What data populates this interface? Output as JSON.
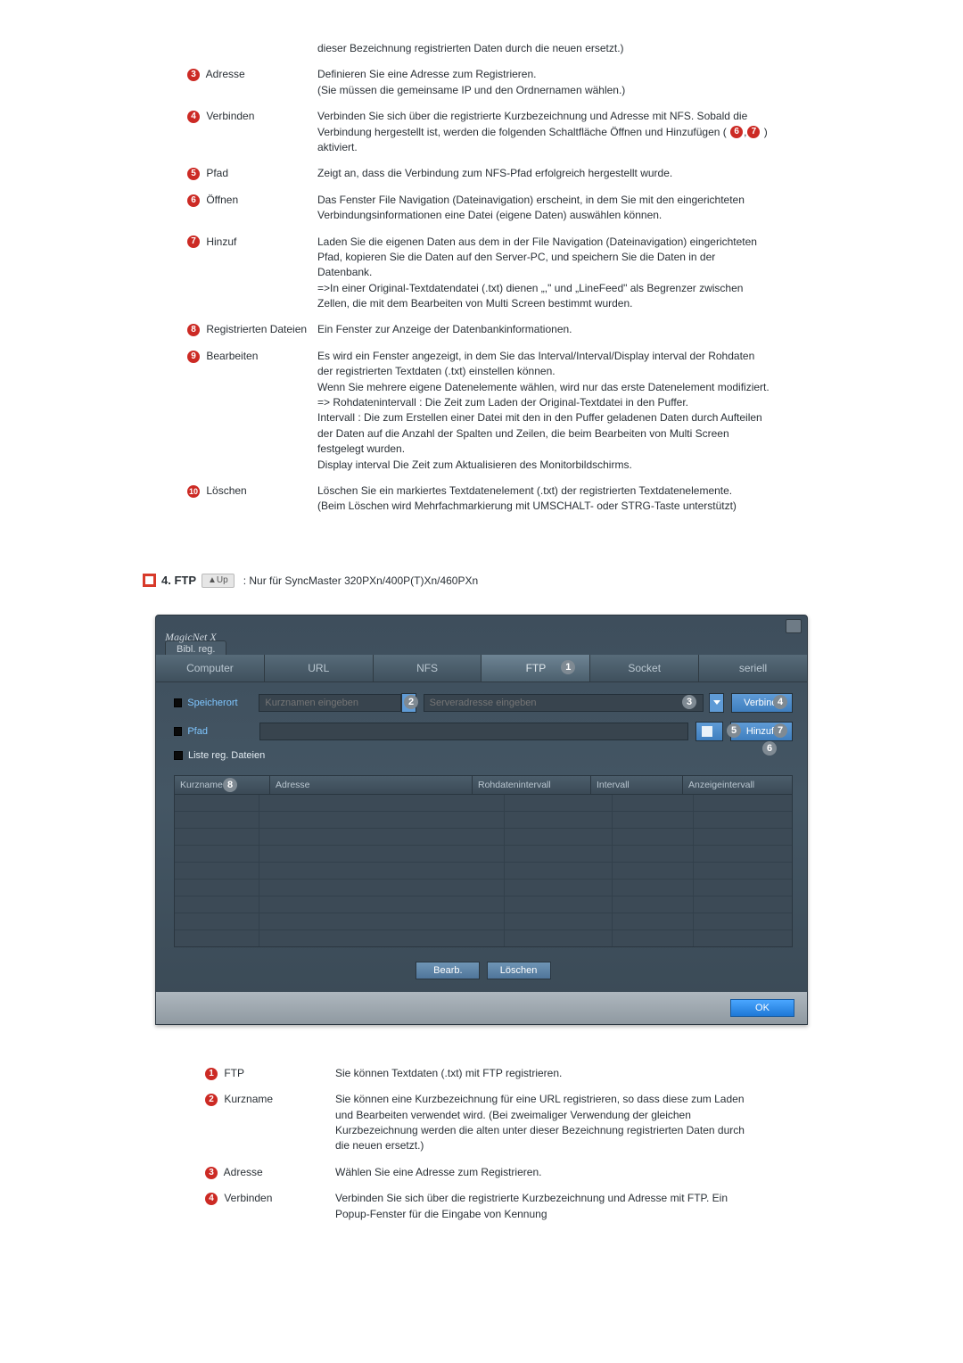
{
  "top_desc": [
    {
      "n": "",
      "label": "",
      "text": "dieser Bezeichnung registrierten Daten durch die neuen ersetzt.)"
    },
    {
      "n": "3",
      "label": "Adresse",
      "text": "Definieren Sie eine Adresse zum Registrieren.\n(Sie müssen die gemeinsame IP und den Ordnernamen wählen.)"
    },
    {
      "n": "4",
      "label": "Verbinden",
      "text": "Verbinden Sie sich über die registrierte Kurzbezeichnung und Adresse mit NFS. Sobald die Verbindung hergestellt ist, werden die folgenden Schaltfläche Öffnen und Hinzufügen (",
      "tail": ") aktiviert.",
      "inline_nums": [
        "6",
        "7"
      ]
    },
    {
      "n": "5",
      "label": "Pfad",
      "text": "Zeigt an, dass die Verbindung zum NFS-Pfad erfolgreich hergestellt wurde."
    },
    {
      "n": "6",
      "label": "Öffnen",
      "text": "Das Fenster File Navigation (Dateinavigation) erscheint, in dem Sie mit den eingerichteten Verbindungsinformationen eine Datei (eigene Daten) auswählen können."
    },
    {
      "n": "7",
      "label": "Hinzuf",
      "text": "Laden Sie die eigenen Daten aus dem in der File Navigation (Dateinavigation) eingerichteten Pfad, kopieren Sie die Daten auf den Server-PC, und speichern Sie die Daten in der Datenbank.\n=>In einer Original-Textdatendatei (.txt) dienen „,\" und „LineFeed\" als Begrenzer zwischen Zellen, die mit dem Bearbeiten von Multi Screen bestimmt wurden."
    },
    {
      "n": "8",
      "label": "Registrierten Dateien",
      "text": "Ein Fenster zur Anzeige der Datenbankinformationen."
    },
    {
      "n": "9",
      "label": "Bearbeiten",
      "text": "Es wird ein Fenster angezeigt, in dem Sie das Interval/Interval/Display interval der Rohdaten der registrierten Textdaten (.txt) einstellen können.\nWenn Sie mehrere eigene Datenelemente wählen, wird nur das erste Datenelement modifiziert.\n=> Rohdatenintervall : Die Zeit zum Laden der Original-Textdatei in den Puffer.\nIntervall : Die zum Erstellen einer Datei mit den in den Puffer geladenen Daten durch Aufteilen der Daten auf die Anzahl der Spalten und Zeilen, die beim Bearbeiten von Multi Screen festgelegt wurden.\nDisplay interval Die Zeit zum Aktualisieren des Monitorbildschirms."
    },
    {
      "n": "10",
      "label": "Löschen",
      "text": "Löschen Sie ein markiertes Textdatenelement (.txt) der registrierten Textdatenelemente.\n(Beim Löschen wird Mehrfachmarkierung mit UMSCHALT- oder STRG-Taste unterstützt)"
    }
  ],
  "section": {
    "title": "4. FTP",
    "up": "▲Up",
    "sub": ": Nur für SyncMaster 320PXn/400P(T)Xn/460PXn"
  },
  "app": {
    "brand": "MagicNet X",
    "subtab": "Bibl. reg.",
    "tabs": [
      "Computer",
      "URL",
      "NFS",
      "FTP",
      "Socket",
      "seriell"
    ],
    "labels": {
      "speicherort": "Speicherort",
      "pfad": "Pfad",
      "liste": "Liste reg. Dateien"
    },
    "placeholders": {
      "kurz": "Kurznamen eingeben",
      "server": "Serveradresse eingeben"
    },
    "buttons": {
      "verbind": "Verbind.",
      "hinzuf": "Hinzuf.",
      "bearb": "Bearb.",
      "loeschen": "Löschen",
      "ok": "OK"
    },
    "list_headers": {
      "kurz": "Kurzname",
      "adresse": "Adresse",
      "rohdaten": "Rohdatenintervall",
      "intervall": "Intervall",
      "anzeige": "Anzeigeintervall"
    },
    "annots": {
      "1": "1",
      "2": "2",
      "3": "3",
      "4": "4",
      "5": "5",
      "6": "6",
      "7": "7",
      "8": "8"
    }
  },
  "bottom_desc": [
    {
      "n": "1",
      "label": "FTP",
      "text": "Sie können Textdaten (.txt) mit FTP registrieren."
    },
    {
      "n": "2",
      "label": "Kurzname",
      "text": "Sie können eine Kurzbezeichnung für eine URL registrieren, so dass diese zum Laden und Bearbeiten verwendet wird. (Bei zweimaliger Verwendung der gleichen Kurzbezeichnung werden die alten unter dieser Bezeichnung registrierten Daten durch die neuen ersetzt.)"
    },
    {
      "n": "3",
      "label": "Adresse",
      "text": "Wählen Sie eine Adresse zum Registrieren."
    },
    {
      "n": "4",
      "label": "Verbinden",
      "text": "Verbinden Sie sich über die registrierte Kurzbezeichnung und Adresse mit FTP. Ein Popup-Fenster für die Eingabe von Kennung"
    }
  ]
}
